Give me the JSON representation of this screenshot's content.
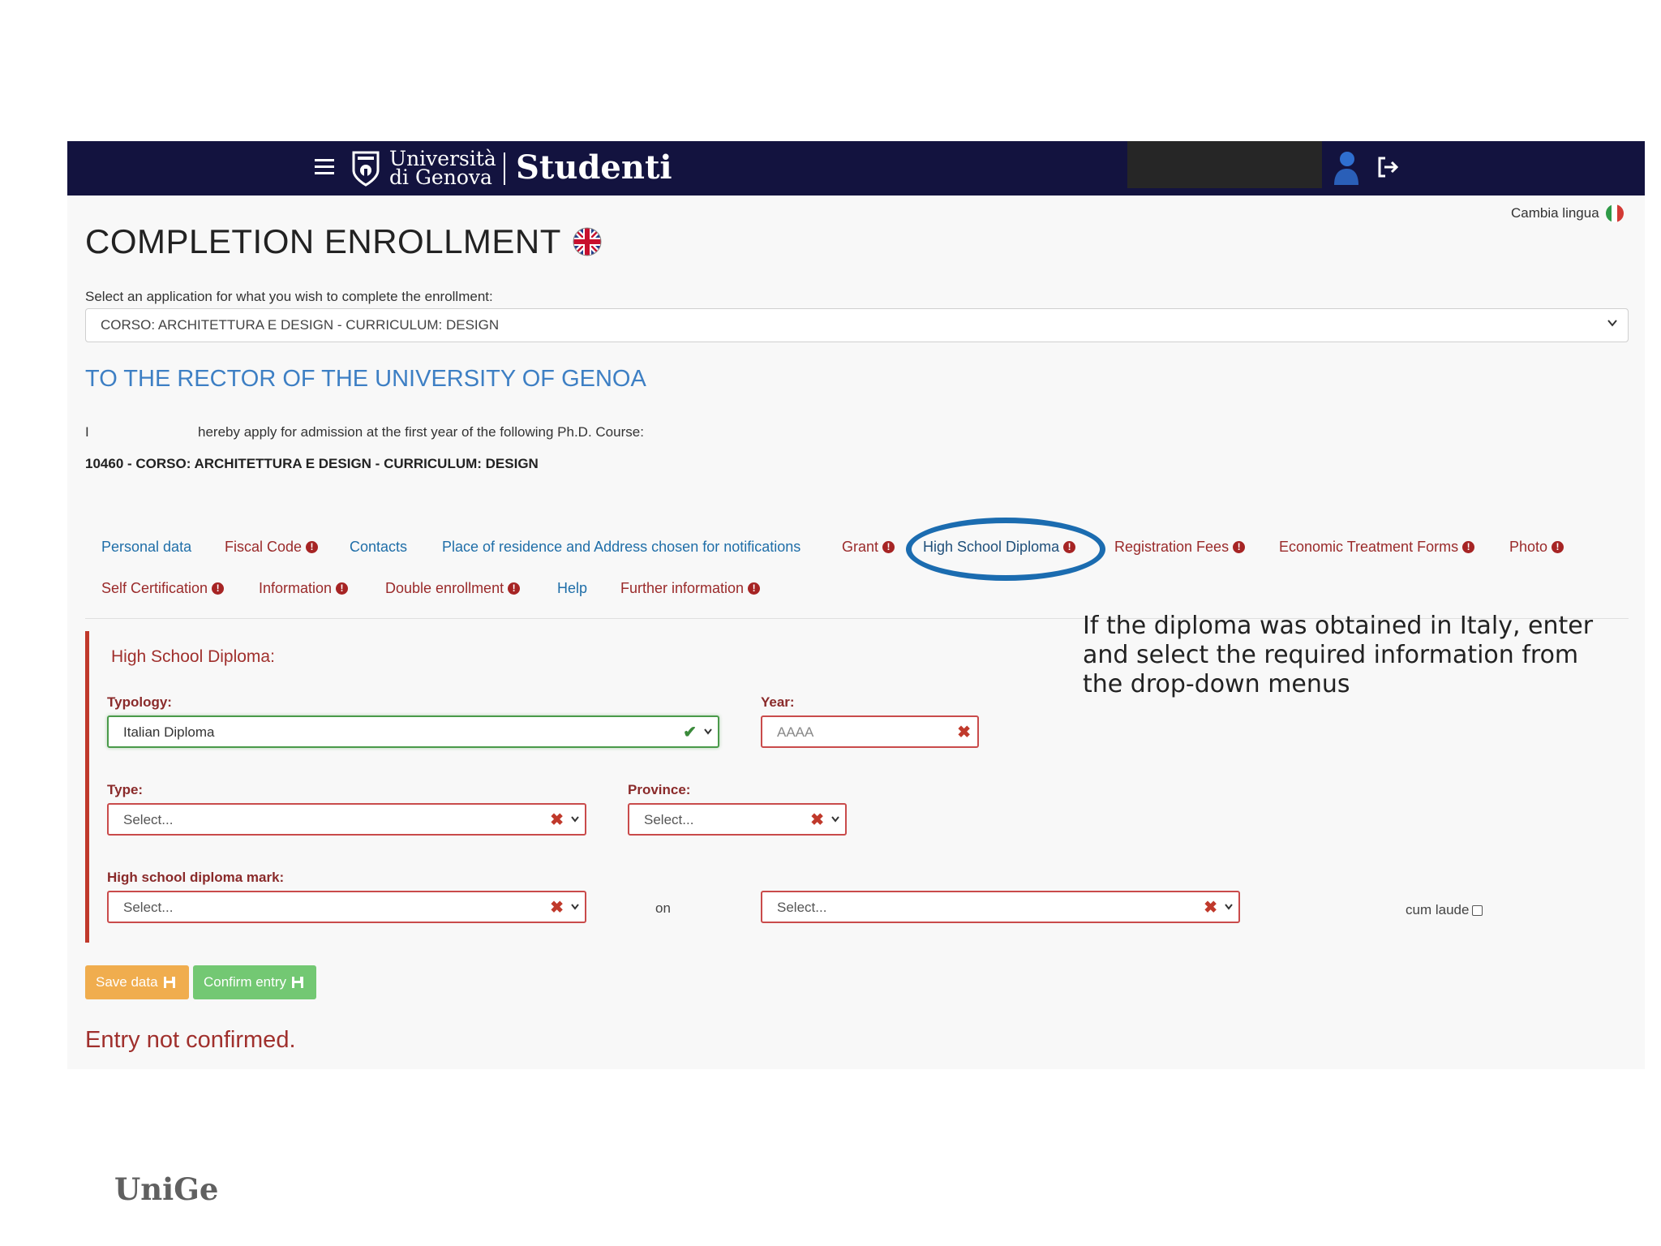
{
  "navbar": {
    "brand_line1": "Università",
    "brand_line2": "di Genova",
    "app_name": "Studenti"
  },
  "language": {
    "label": "Cambia lingua"
  },
  "page": {
    "title": "COMPLETION ENROLLMENT",
    "select_label": "Select an application for what you wish to complete the enrollment:",
    "selected_course": "CORSO: ARCHITETTURA E DESIGN - CURRICULUM: DESIGN",
    "rector_heading": "TO THE RECTOR OF THE UNIVERSITY OF GENOA",
    "apply_prefix": "I",
    "apply_text": "hereby apply for admission at the first year of the following Ph.D. Course:",
    "course_code_line": "10460 - CORSO: ARCHITETTURA E DESIGN - CURRICULUM: DESIGN"
  },
  "tabs": [
    {
      "label": "Personal data",
      "warning": false
    },
    {
      "label": "Fiscal Code",
      "warning": true
    },
    {
      "label": "Contacts",
      "warning": false
    },
    {
      "label": "Place of residence and Address chosen for notifications",
      "warning": false
    },
    {
      "label": "Grant",
      "warning": true
    },
    {
      "label": "High School Diploma",
      "warning": true,
      "active": true
    },
    {
      "label": "Registration Fees",
      "warning": true
    },
    {
      "label": "Economic Treatment Forms",
      "warning": true
    },
    {
      "label": "Photo",
      "warning": true
    },
    {
      "label": "Self Certification",
      "warning": true
    },
    {
      "label": "Information",
      "warning": true
    },
    {
      "label": "Double enrollment",
      "warning": true
    },
    {
      "label": "Help",
      "warning": false
    },
    {
      "label": "Further information",
      "warning": true
    }
  ],
  "annotation": {
    "text": "If the diploma was obtained in Italy, enter and select the required information from the drop-down menus"
  },
  "form": {
    "title": "High School Diploma:",
    "typology": {
      "label": "Typology:",
      "value": "Italian Diploma",
      "status": "valid"
    },
    "year": {
      "label": "Year:",
      "placeholder": "AAAA",
      "status": "invalid"
    },
    "type": {
      "label": "Type:",
      "value": "Select...",
      "status": "invalid"
    },
    "province": {
      "label": "Province:",
      "value": "Select...",
      "status": "invalid"
    },
    "mark": {
      "label": "High school diploma mark:",
      "value": "Select...",
      "status": "invalid"
    },
    "on_label": "on",
    "mark_base": {
      "value": "Select...",
      "status": "invalid"
    },
    "cum_laude": {
      "label": "cum laude",
      "checked": false
    }
  },
  "buttons": {
    "save": "Save data",
    "confirm": "Confirm entry"
  },
  "status_message": "Entry not confirmed.",
  "footer_logo": "UniGe",
  "colors": {
    "navbar": "#13133f",
    "link": "#1f6ea8",
    "error": "#a0302d",
    "annotation_circle": "#1b6cb0",
    "save_button": "#f0ad4e",
    "confirm_button": "#73c873"
  }
}
